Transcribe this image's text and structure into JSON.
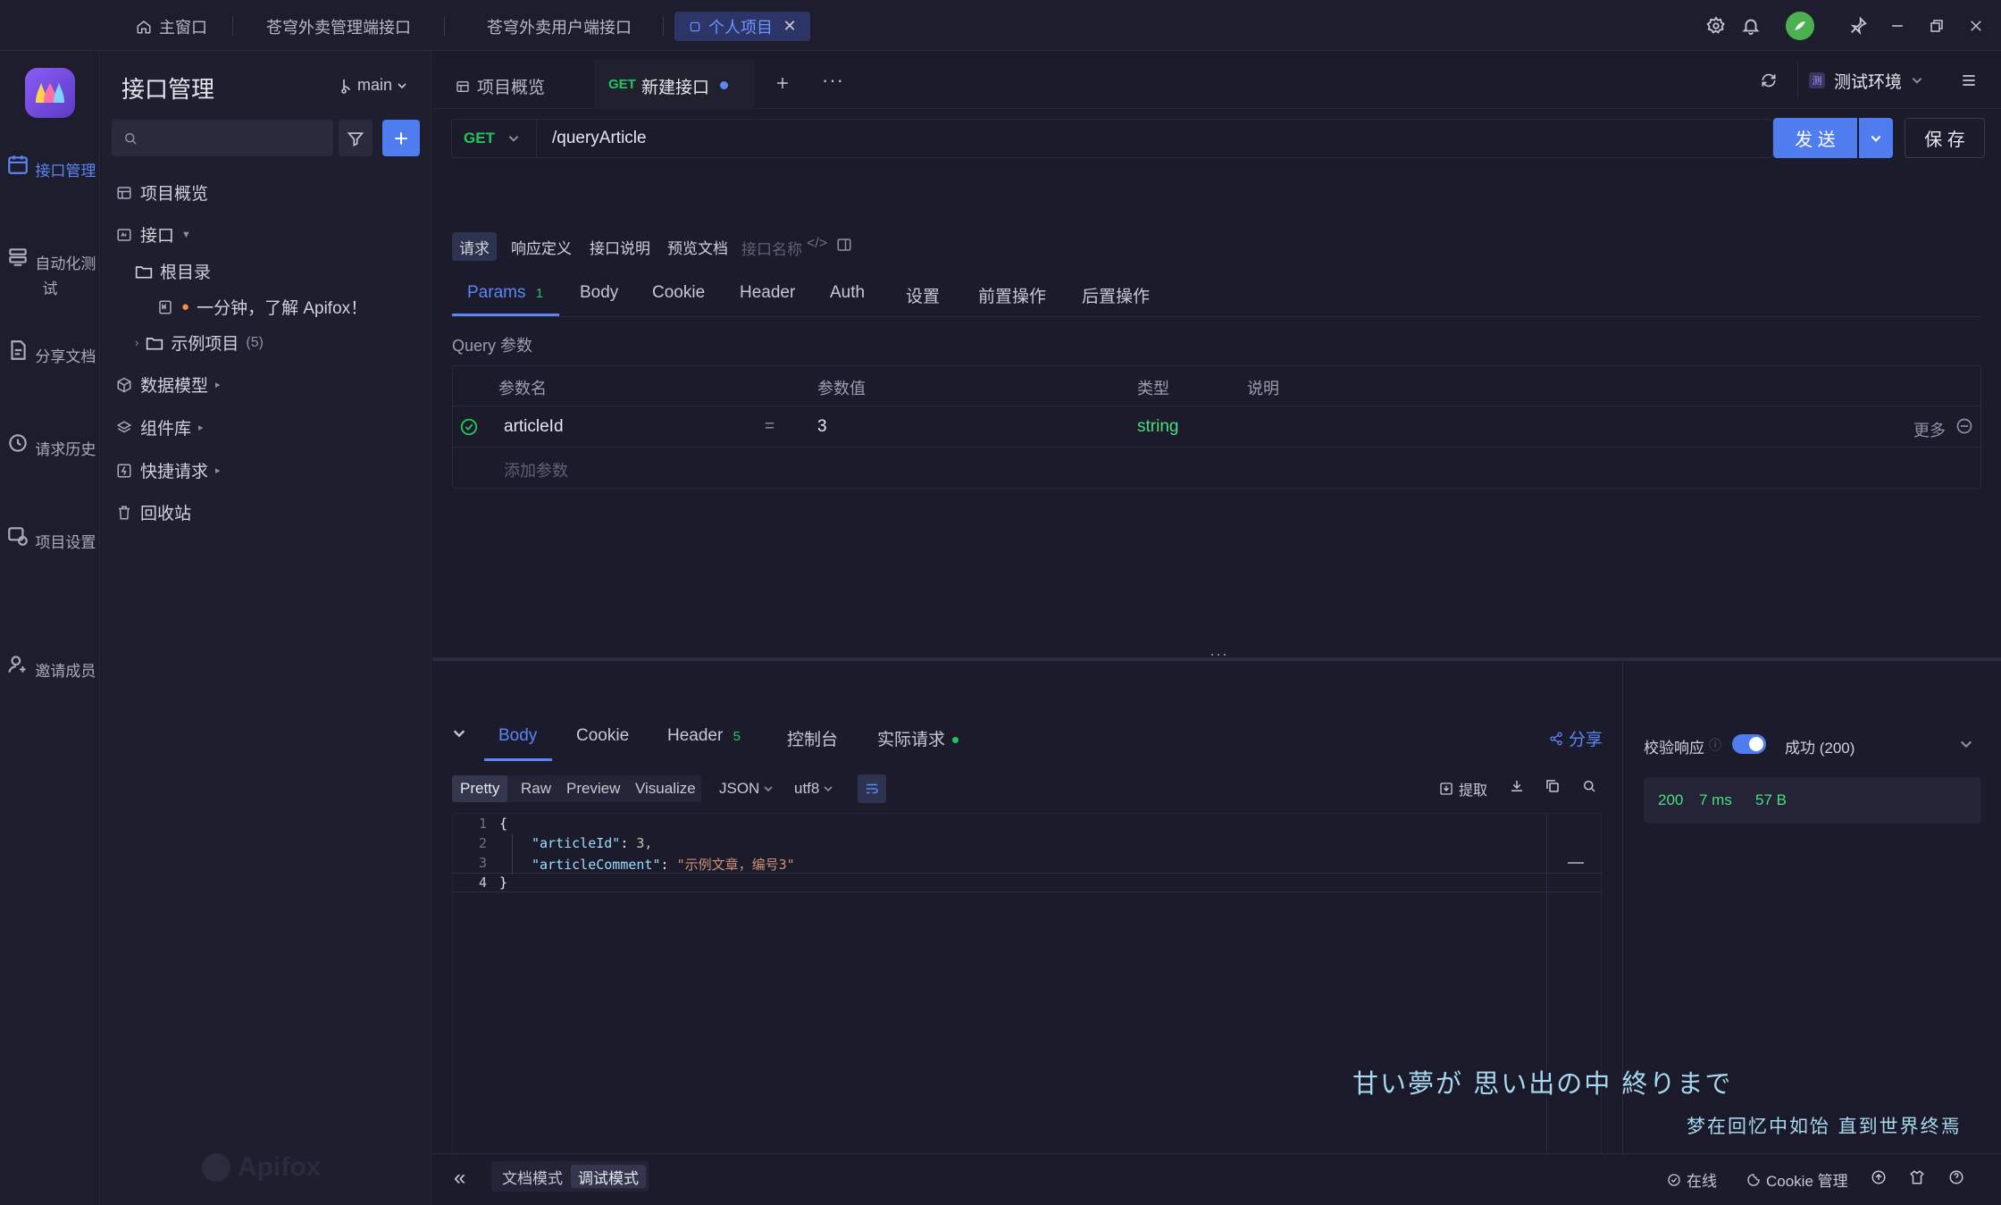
{
  "titlebar": {
    "tabs": [
      {
        "label": "主窗口"
      },
      {
        "label": "苍穹外卖管理端接口"
      },
      {
        "label": "苍穹外卖用户端接口"
      },
      {
        "label": "个人项目"
      }
    ]
  },
  "rail": {
    "items": [
      {
        "label": "接口管理"
      },
      {
        "label": "自动化测试"
      },
      {
        "label": "分享文档"
      },
      {
        "label": "请求历史"
      },
      {
        "label": "项目设置"
      },
      {
        "label": "邀请成员"
      }
    ]
  },
  "sidebar": {
    "title": "接口管理",
    "branch": "main",
    "search_placeholder": "",
    "tree": {
      "overview": "项目概览",
      "api": "接口",
      "root": "根目录",
      "doc": "一分钟，了解 Apifox！",
      "example": "示例项目",
      "example_count": "(5)",
      "schemas": "数据模型",
      "components": "组件库",
      "quick": "快捷请求",
      "trash": "回收站"
    },
    "watermark": "Apifox"
  },
  "main": {
    "tabs": {
      "overview": "项目概览",
      "method": "GET",
      "current": "新建接口"
    },
    "env": "测试环境",
    "env_badge": "测",
    "request": {
      "method": "GET",
      "url": "/queryArticle",
      "send": "发 送",
      "save": "保 存"
    },
    "subtabs": [
      "请求",
      "响应定义",
      "接口说明",
      "预览文档"
    ],
    "name_placeholder": "接口名称",
    "param_tabs": {
      "params": "Params",
      "params_count": "1",
      "others": [
        "Body",
        "Cookie",
        "Header",
        "Auth",
        "设置",
        "前置操作",
        "后置操作"
      ]
    },
    "query_title": "Query 参数",
    "headers": [
      "参数名",
      "参数值",
      "类型",
      "说明"
    ],
    "param_row": {
      "name": "articleId",
      "eq": "=",
      "value": "3",
      "type": "string",
      "more": "更多"
    },
    "add_param": "添加参数"
  },
  "response": {
    "tabs": {
      "body": "Body",
      "cookie": "Cookie",
      "header": "Header",
      "header_count": "5",
      "console": "控制台",
      "actual": "实际请求"
    },
    "share": "分享",
    "formats": [
      "Pretty",
      "Raw",
      "Preview",
      "Visualize"
    ],
    "lang": "JSON",
    "encoding": "utf8",
    "extract": "提取",
    "code_lines": [
      {
        "num": "1",
        "text": "{"
      },
      {
        "num": "2",
        "key": "\"articleId\"",
        "sep": ": ",
        "val": "3,"
      },
      {
        "num": "3",
        "key": "\"articleComment\"",
        "sep": ": ",
        "val": "\"示例文章，编号3\""
      },
      {
        "num": "4",
        "text": "}"
      }
    ],
    "validate": "校验响应",
    "status_select": "成功 (200)",
    "stats": {
      "code": "200",
      "time": "7 ms",
      "size": "57 B"
    }
  },
  "lyrics": {
    "jp": "甘い夢が 思い出の中 終りまで",
    "cn": "梦在回忆中如饴 直到世界终焉"
  },
  "footer": {
    "modes": [
      "文档模式",
      "调试模式"
    ],
    "online": "在线",
    "cookie": "Cookie 管理"
  },
  "colors": {
    "accent": "#5b86f5",
    "get": "#22c55e",
    "string_type": "#4ade80",
    "background": "#1b1b2b"
  }
}
